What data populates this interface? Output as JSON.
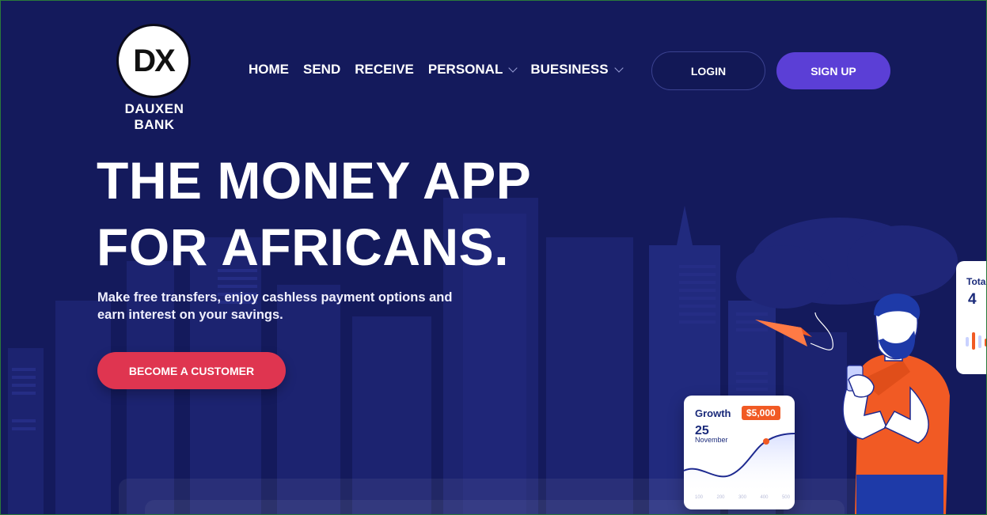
{
  "brand": {
    "logo_mark": "DX",
    "name": "DAUXEN BANK"
  },
  "nav": {
    "items": [
      {
        "label": "HOME",
        "has_dropdown": false
      },
      {
        "label": "SEND",
        "has_dropdown": false
      },
      {
        "label": "RECEIVE",
        "has_dropdown": false
      },
      {
        "label": "PERSONAL",
        "has_dropdown": true
      },
      {
        "label": "BUESINESS",
        "has_dropdown": true
      }
    ]
  },
  "auth": {
    "login_label": "LOGIN",
    "signup_label": "SIGN UP"
  },
  "hero": {
    "headline_line1": "THE MONEY APP",
    "headline_line2": "FOR AFRICANS.",
    "subtext": "Make free transfers, enjoy cashless payment options and earn interest on your savings.",
    "cta_label": "BECOME A CUSTOMER"
  },
  "growth_card": {
    "title": "Growth",
    "amount": "$5,000",
    "day": "25",
    "month": "November",
    "axis": [
      "100",
      "200",
      "300",
      "400",
      "500"
    ]
  },
  "total_card": {
    "label": "Tota",
    "value": "4"
  },
  "colors": {
    "background": "#141a5c",
    "signup": "#5b3fd6",
    "cta": "#df3550",
    "accent_orange": "#f15a24"
  }
}
